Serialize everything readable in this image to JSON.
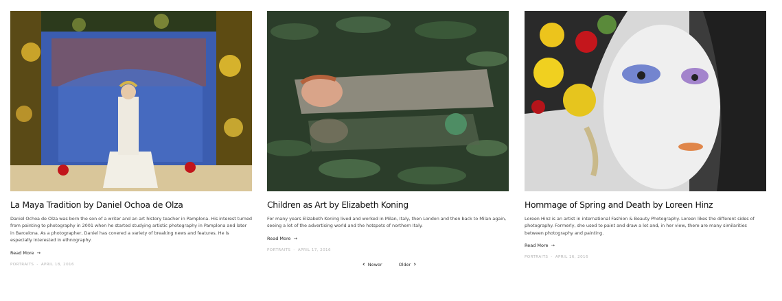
{
  "posts": [
    {
      "title": "La Maya Tradition by Daniel Ochoa de Olza",
      "excerpt": "Daniel Ochoa de Olza was born the son of a writer and an art history teacher in Pamplona. His interest turned from painting to photography in 2001 when he started studying artistic photography in Pamplona and later in Barcelona. As a photographer, Daniel has covered a variety of breaking news and features. He is especially interested in ethnography.",
      "read_more": "Read More",
      "read_more_arrow": "→",
      "category": "PORTRAITS",
      "separator": "-",
      "date": "APRIL 18, 2016"
    },
    {
      "title": "Children as Art by Elizabeth Koning",
      "excerpt": "For many years Elizabeth Koning lived and worked in Milan, Italy, then London and then back to Milan again, seeing a lot of the advertising world and the hotspots of northern Italy.",
      "read_more": "Read More",
      "read_more_arrow": "→",
      "category": "PORTRAITS",
      "separator": "-",
      "date": "APRIL 17, 2016"
    },
    {
      "title": "Hommage of Spring and Death by Loreen Hinz",
      "excerpt": "Loreen Hinz is an artist in international Fashion & Beauty Photography. Loreen likes the different sides of photography. Formerly, she used to paint and draw a lot and, in her view, there are many similarities between photography and painting.",
      "read_more": "Read More",
      "read_more_arrow": "→",
      "category": "PORTRAITS",
      "separator": "-",
      "date": "APRIL 16, 2016"
    }
  ],
  "pagination": {
    "newer": "Newer",
    "older": "Older",
    "prev_icon": "‹",
    "next_icon": "›"
  },
  "colors": {
    "title": "#111111",
    "meta": "#b3b3b3",
    "body": "#444444"
  }
}
